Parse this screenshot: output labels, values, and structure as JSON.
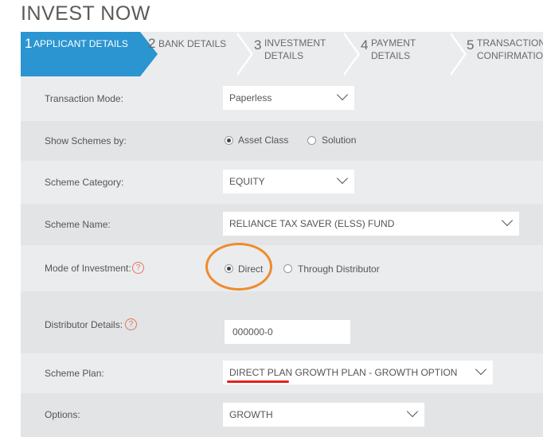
{
  "page": {
    "title": "INVEST NOW"
  },
  "steps": [
    {
      "num": "1",
      "label": "APPLICANT DETAILS"
    },
    {
      "num": "2",
      "label": "BANK DETAILS"
    },
    {
      "num": "3",
      "label_line1": "INVESTMENT",
      "label_line2": "DETAILS"
    },
    {
      "num": "4",
      "label_line1": "PAYMENT",
      "label_line2": "DETAILS"
    },
    {
      "num": "5",
      "label_line1": "TRANSACTION",
      "label_line2": "CONFIRMATION"
    }
  ],
  "form": {
    "transaction_mode": {
      "label": "Transaction Mode:",
      "value": "Paperless"
    },
    "show_schemes": {
      "label": "Show Schemes by:",
      "options": [
        "Asset Class",
        "Solution"
      ],
      "selected": "Asset Class"
    },
    "scheme_category": {
      "label": "Scheme Category:",
      "value": "EQUITY"
    },
    "scheme_name": {
      "label": "Scheme Name:",
      "value": "RELIANCE TAX SAVER (ELSS) FUND"
    },
    "mode_of_investment": {
      "label": "Mode of Investment:",
      "options": [
        "Direct",
        "Through Distributor"
      ],
      "selected": "Direct"
    },
    "distributor_details": {
      "label": "Distributor Details:",
      "value": "000000-0"
    },
    "scheme_plan": {
      "label": "Scheme Plan:",
      "value": "DIRECT PLAN GROWTH PLAN - GROWTH OPTION"
    },
    "options": {
      "label": "Options:",
      "value": "GROWTH"
    }
  },
  "icons": {
    "help": "?"
  },
  "colors": {
    "active_step": "#2a95d1",
    "highlight_circle": "#f08a2a",
    "underline": "#e02020",
    "help_icon": "#e8735a"
  }
}
